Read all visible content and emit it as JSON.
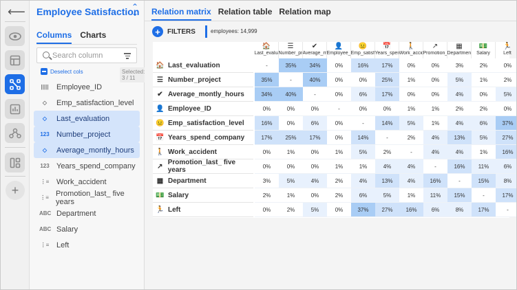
{
  "app": {
    "title": "Employee Satisfaction"
  },
  "rail": {
    "icons": [
      "back-arrow-icon",
      "eye-icon",
      "layout-icon",
      "relations-icon",
      "bar-chart-icon",
      "network-icon",
      "dashboard-icon",
      "plus-icon"
    ]
  },
  "panel": {
    "tab_columns": "Columns",
    "tab_charts": "Charts",
    "search_placeholder": "Search column",
    "deselect_label": "Deselect cols",
    "selected_label": "Selected: 3 / 11",
    "columns": [
      {
        "label": "Employee_ID",
        "type": "id",
        "icon": "|||||",
        "selected": false
      },
      {
        "label": "Emp_satisfaction_level",
        "type": "tag",
        "icon": "◇",
        "selected": false
      },
      {
        "label": "Last_evaluation",
        "type": "tag",
        "icon": "◇",
        "selected": true
      },
      {
        "label": "Number_project",
        "type": "numeric",
        "icon": "123",
        "selected": true
      },
      {
        "label": "Average_montly_hours",
        "type": "tag",
        "icon": "◇",
        "selected": true
      },
      {
        "label": "Years_spend_company",
        "type": "numeric",
        "icon": "123",
        "selected": false
      },
      {
        "label": "Work_accident",
        "type": "list",
        "icon": "⋮≡",
        "selected": false
      },
      {
        "label": "Promotion_last_ five years",
        "type": "list",
        "icon": "⋮≡",
        "selected": false
      },
      {
        "label": "Department",
        "type": "text",
        "icon": "ABC",
        "selected": false
      },
      {
        "label": "Salary",
        "type": "text",
        "icon": "ABC",
        "selected": false
      },
      {
        "label": "Left",
        "type": "list",
        "icon": "⋮≡",
        "selected": false
      }
    ]
  },
  "main": {
    "tabs": [
      "Relation matrix",
      "Relation table",
      "Relation map"
    ],
    "filters_label": "FILTERS",
    "employees_label": "employees: 14,999"
  },
  "colors": {
    "accent": "#1e6ee6",
    "cell_high": "#a9cdf5",
    "cell_mid": "#cfe2fa",
    "cell_low": "#e8f1fd"
  },
  "chart_data": {
    "type": "heatmap",
    "rows": [
      {
        "label": "Last_evaluation",
        "icon": "🏠"
      },
      {
        "label": "Number_project",
        "icon": "☰"
      },
      {
        "label": "Average_montly_hours",
        "icon": "✔"
      },
      {
        "label": "Employee_ID",
        "icon": "👤"
      },
      {
        "label": "Emp_satisfaction_level",
        "icon": "😐"
      },
      {
        "label": "Years_spend_company",
        "icon": "📅"
      },
      {
        "label": "Work_accident",
        "icon": "🚶"
      },
      {
        "label": "Promotion_last_ five years",
        "icon": "↗"
      },
      {
        "label": "Department",
        "icon": "▦"
      },
      {
        "label": "Salary",
        "icon": "💵"
      },
      {
        "label": "Left",
        "icon": "🏃"
      }
    ],
    "columns": [
      {
        "label": "Last_evaluation",
        "icon": "🏠"
      },
      {
        "label": "Number_project",
        "icon": "☰"
      },
      {
        "label": "Average_montly_hours",
        "icon": "✔"
      },
      {
        "label": "Employee_ID",
        "icon": "👤"
      },
      {
        "label": "Emp_satisfaction_level",
        "icon": "😐"
      },
      {
        "label": "Years_spend_company",
        "icon": "📅"
      },
      {
        "label": "Work_accident",
        "icon": "🚶"
      },
      {
        "label": "Promotion_last_five_years",
        "icon": "↗"
      },
      {
        "label": "Department",
        "icon": "▦"
      },
      {
        "label": "Salary",
        "icon": "💵"
      },
      {
        "label": "Left",
        "icon": "🏃"
      }
    ],
    "values": [
      [
        "-",
        "35%",
        "34%",
        "0%",
        "16%",
        "17%",
        "0%",
        "0%",
        "3%",
        "2%",
        "0%"
      ],
      [
        "35%",
        "-",
        "40%",
        "0%",
        "0%",
        "25%",
        "1%",
        "0%",
        "5%",
        "1%",
        "2%"
      ],
      [
        "34%",
        "40%",
        "-",
        "0%",
        "6%",
        "17%",
        "0%",
        "0%",
        "4%",
        "0%",
        "5%"
      ],
      [
        "0%",
        "0%",
        "0%",
        "-",
        "0%",
        "0%",
        "1%",
        "1%",
        "2%",
        "2%",
        "0%"
      ],
      [
        "16%",
        "0%",
        "6%",
        "0%",
        "-",
        "14%",
        "5%",
        "1%",
        "4%",
        "6%",
        "37%"
      ],
      [
        "17%",
        "25%",
        "17%",
        "0%",
        "14%",
        "-",
        "2%",
        "4%",
        "13%",
        "5%",
        "27%"
      ],
      [
        "0%",
        "1%",
        "0%",
        "1%",
        "5%",
        "2%",
        "-",
        "4%",
        "4%",
        "1%",
        "16%"
      ],
      [
        "0%",
        "0%",
        "0%",
        "1%",
        "1%",
        "4%",
        "4%",
        "-",
        "16%",
        "11%",
        "6%"
      ],
      [
        "3%",
        "5%",
        "4%",
        "2%",
        "4%",
        "13%",
        "4%",
        "16%",
        "-",
        "15%",
        "8%"
      ],
      [
        "2%",
        "1%",
        "0%",
        "2%",
        "6%",
        "5%",
        "1%",
        "11%",
        "15%",
        "-",
        "17%"
      ],
      [
        "0%",
        "2%",
        "5%",
        "0%",
        "37%",
        "27%",
        "16%",
        "6%",
        "8%",
        "17%",
        "-"
      ]
    ]
  }
}
